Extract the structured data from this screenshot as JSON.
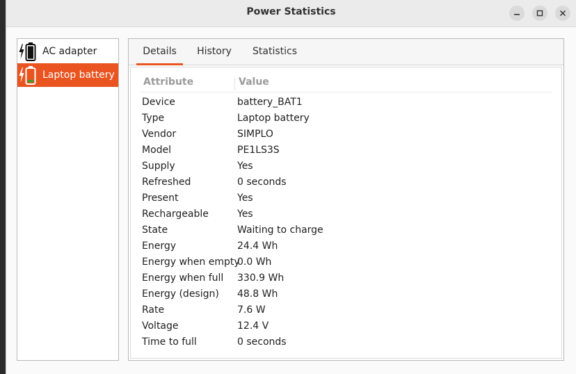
{
  "window": {
    "title": "Power Statistics"
  },
  "sidebar": {
    "items": [
      {
        "label": "AC adapter",
        "icon": "ac-adapter-icon"
      },
      {
        "label": "Laptop battery",
        "icon": "battery-charging-icon",
        "selected": true
      }
    ]
  },
  "tabs": [
    {
      "label": "Details",
      "active": true
    },
    {
      "label": "History"
    },
    {
      "label": "Statistics"
    }
  ],
  "table": {
    "columns": {
      "attribute": "Attribute",
      "value": "Value"
    },
    "rows": [
      {
        "attribute": "Device",
        "value": "battery_BAT1"
      },
      {
        "attribute": "Type",
        "value": "Laptop battery"
      },
      {
        "attribute": "Vendor",
        "value": "SIMPLO"
      },
      {
        "attribute": "Model",
        "value": "PE1LS3S"
      },
      {
        "attribute": "Supply",
        "value": "Yes"
      },
      {
        "attribute": "Refreshed",
        "value": "0 seconds"
      },
      {
        "attribute": "Present",
        "value": "Yes"
      },
      {
        "attribute": "Rechargeable",
        "value": "Yes"
      },
      {
        "attribute": "State",
        "value": "Waiting to charge"
      },
      {
        "attribute": "Energy",
        "value": "24.4 Wh"
      },
      {
        "attribute": "Energy when empty",
        "value": "0.0 Wh"
      },
      {
        "attribute": "Energy when full",
        "value": "330.9 Wh"
      },
      {
        "attribute": "Energy (design)",
        "value": "48.8 Wh"
      },
      {
        "attribute": "Rate",
        "value": "7.6 W"
      },
      {
        "attribute": "Voltage",
        "value": "12.4 V"
      },
      {
        "attribute": "Time to full",
        "value": "0 seconds"
      }
    ]
  },
  "colors": {
    "accent": "#e95420",
    "battery_level": "#3c9e2c"
  }
}
